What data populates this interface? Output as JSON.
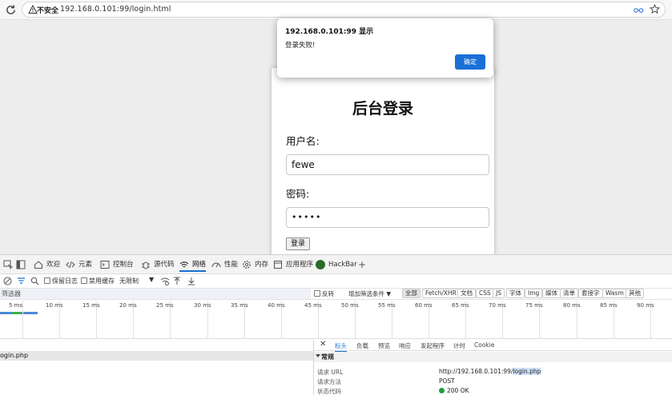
{
  "browser": {
    "security_label": "不安全",
    "url": "192.168.0.101:99/login.html"
  },
  "login": {
    "title": "后台登录",
    "username_label": "用户名:",
    "username_value": "fewe",
    "password_label": "密码:",
    "password_value": "•••••",
    "submit_label": "登录"
  },
  "alert": {
    "title": "192.168.0.101:99 显示",
    "message": "登录失败!",
    "ok_label": "确定"
  },
  "devtools": {
    "tabs": [
      {
        "label": "欢迎",
        "icon": "home-icon"
      },
      {
        "label": "元素",
        "icon": "code-icon"
      },
      {
        "label": "控制台",
        "icon": "console-icon"
      },
      {
        "label": "源代码",
        "icon": "bug-icon"
      },
      {
        "label": "网络",
        "icon": "wifi-icon"
      },
      {
        "label": "性能",
        "icon": "gauge-icon"
      },
      {
        "label": "内存",
        "icon": "gear-icon"
      },
      {
        "label": "应用程序",
        "icon": "window-icon"
      },
      {
        "label": "HackBar",
        "icon": "hackbar-logo"
      }
    ],
    "toolbar": {
      "preserve_log": "保留日志",
      "disable_cache": "禁用缓存",
      "throttle": "无限制"
    },
    "filterbar": {
      "filter_placeholder": "筛选器",
      "invert": "反转",
      "more_filters": "增加筛选条件",
      "chips": [
        "全部",
        "Fetch/XHR",
        "文档",
        "CSS",
        "JS",
        "字体",
        "Img",
        "媒体",
        "清单",
        "套接字",
        "Wasm",
        "其他"
      ]
    },
    "timeline": {
      "ticks": [
        "5 ms",
        "10 ms",
        "15 ms",
        "20 ms",
        "25 ms",
        "30 ms",
        "35 ms",
        "40 ms",
        "45 ms",
        "50 ms",
        "55 ms",
        "60 ms",
        "65 ms",
        "70 ms",
        "75 ms",
        "80 ms",
        "85 ms",
        "90 ms"
      ]
    },
    "request": {
      "name": "ogin.php"
    },
    "detail": {
      "tabs": [
        "标头",
        "负载",
        "预览",
        "响应",
        "发起程序",
        "计时",
        "Cookie"
      ],
      "section": "常规",
      "rows": [
        {
          "key": "请求 URL",
          "value_prefix": "http://192.168.0.101:99/",
          "value_highlight": "login.php"
        },
        {
          "key": "请求方法",
          "value": "POST"
        },
        {
          "key": "状态代码",
          "value": "200 OK"
        }
      ]
    }
  }
}
